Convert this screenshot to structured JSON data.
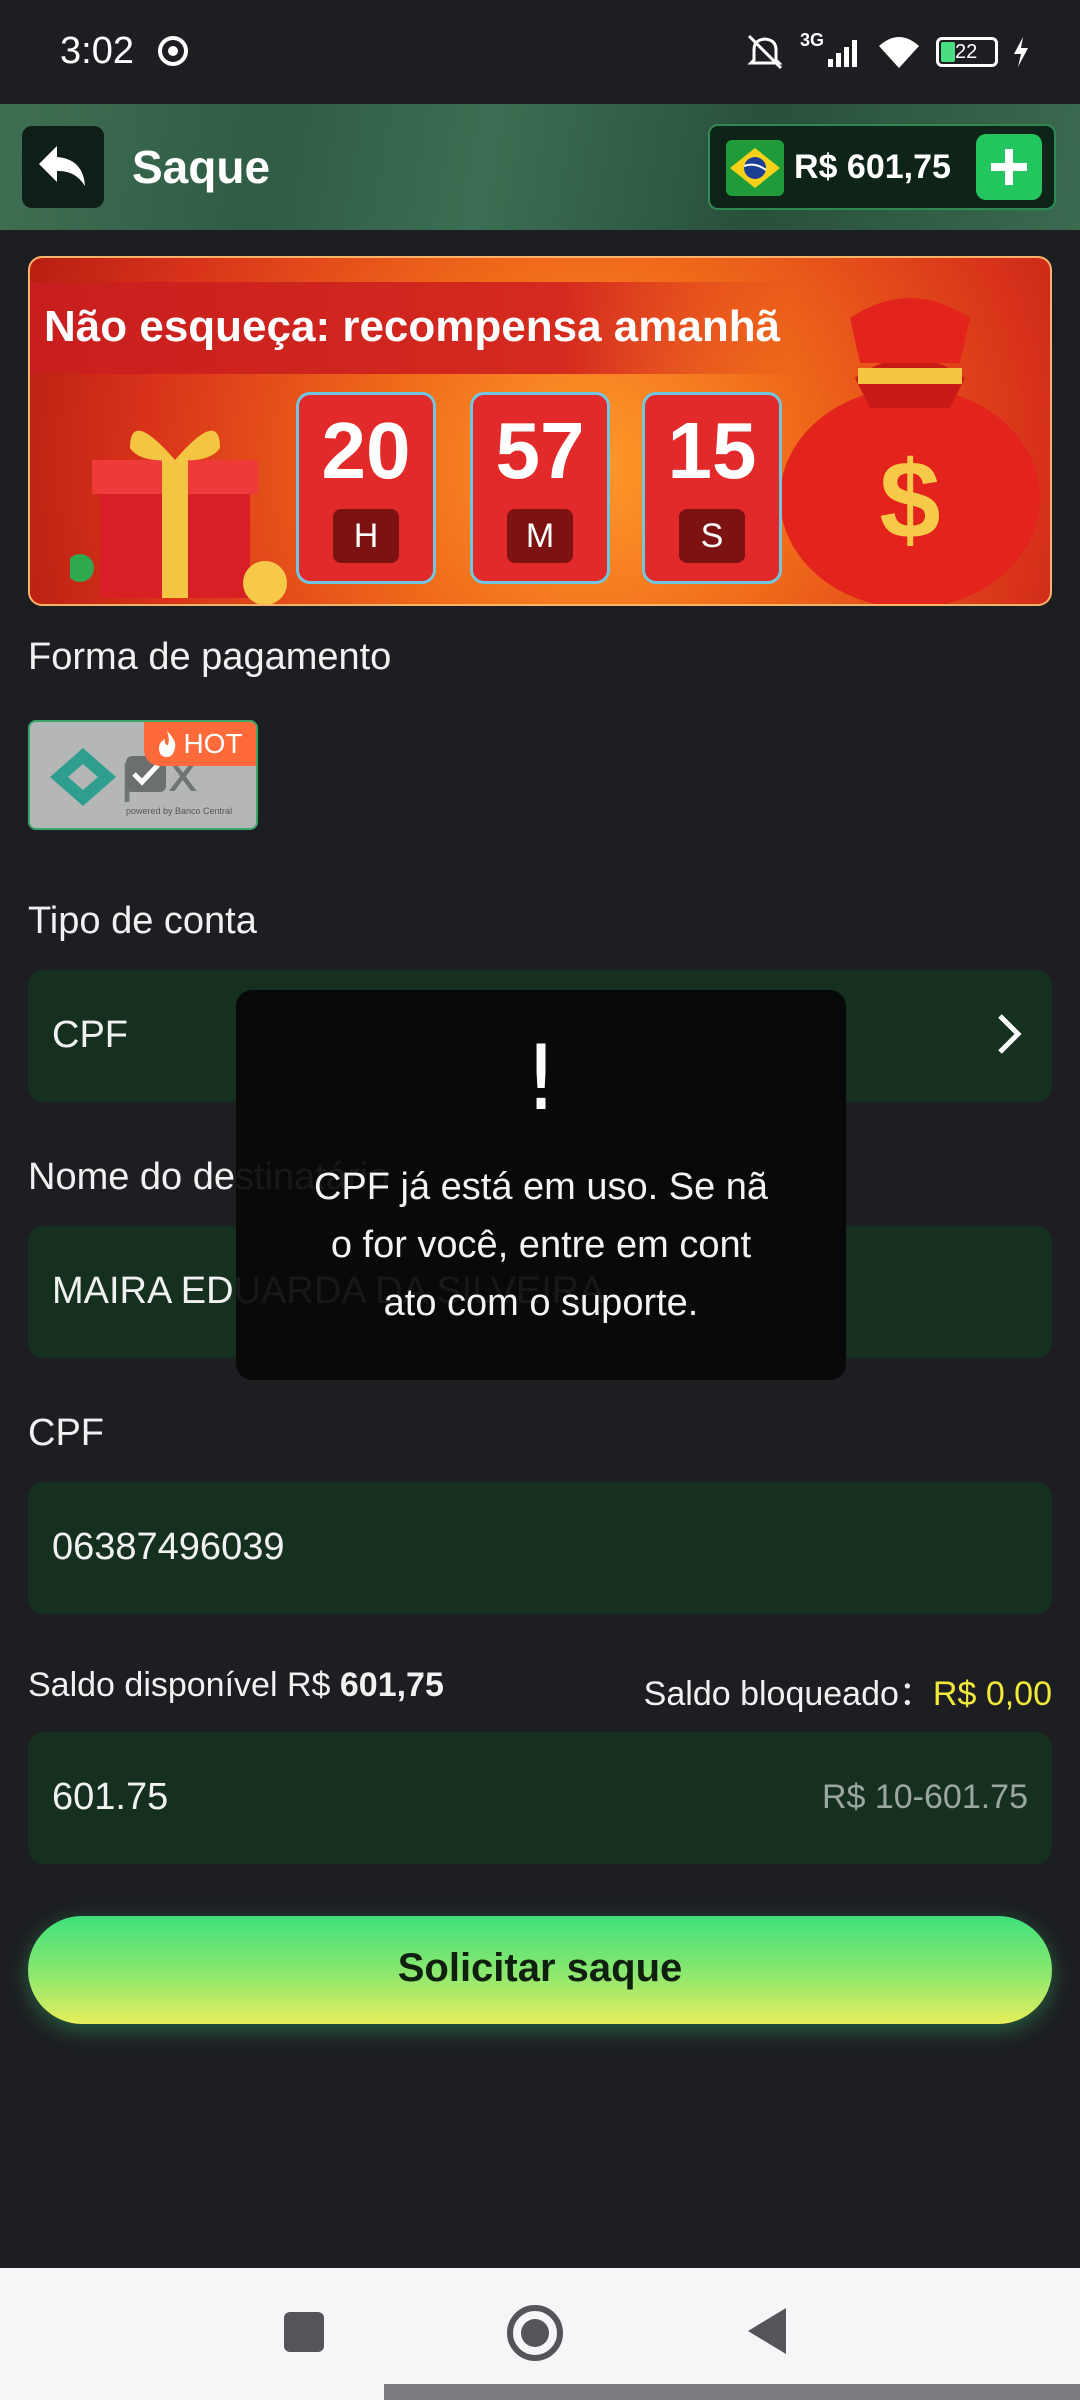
{
  "status_bar": {
    "time": "3:02",
    "network": "3G",
    "battery": "22"
  },
  "header": {
    "title": "Saque",
    "balance": "R$ 601,75"
  },
  "banner": {
    "text": "Não esqueça: recompensa amanhã",
    "countdown": [
      {
        "value": "20",
        "unit": "H"
      },
      {
        "value": "57",
        "unit": "M"
      },
      {
        "value": "15",
        "unit": "S"
      }
    ]
  },
  "payment": {
    "label": "Forma de pagamento",
    "method": "pix",
    "method_caption": "powered by Banco Central",
    "badge": "HOT"
  },
  "account_type": {
    "label": "Tipo de conta",
    "value": "CPF"
  },
  "recipient": {
    "label": "Nome do destinatário",
    "value": "MAIRA EDUARDA DA SILVEIRA"
  },
  "cpf": {
    "label": "CPF",
    "value": "06387496039"
  },
  "saldo": {
    "available_label": "Saldo disponível R$ ",
    "available_value": "601,75",
    "blocked_label": "Saldo bloqueado：",
    "blocked_value": "R$ 0,00"
  },
  "amount": {
    "value": "601.75",
    "range": "R$ 10-601.75"
  },
  "submit_label": "Solicitar saque",
  "toast": {
    "icon": "!",
    "lines": [
      "CPF já está em uso. Se nã",
      "o for você, entre em cont",
      "ato com o suporte."
    ]
  },
  "colors": {
    "background": "#1d1e22",
    "field": "#16301f",
    "accent_green": "#22c55e",
    "yellow": "#f2e83a",
    "banner_red": "#e32a2a"
  },
  "icons": [
    "back-arrow-icon",
    "brazil-flag-icon",
    "plus-icon",
    "chevron-right-icon",
    "fire-icon",
    "pix-logo-icon",
    "nav-recents-icon",
    "nav-home-icon",
    "nav-back-icon"
  ]
}
